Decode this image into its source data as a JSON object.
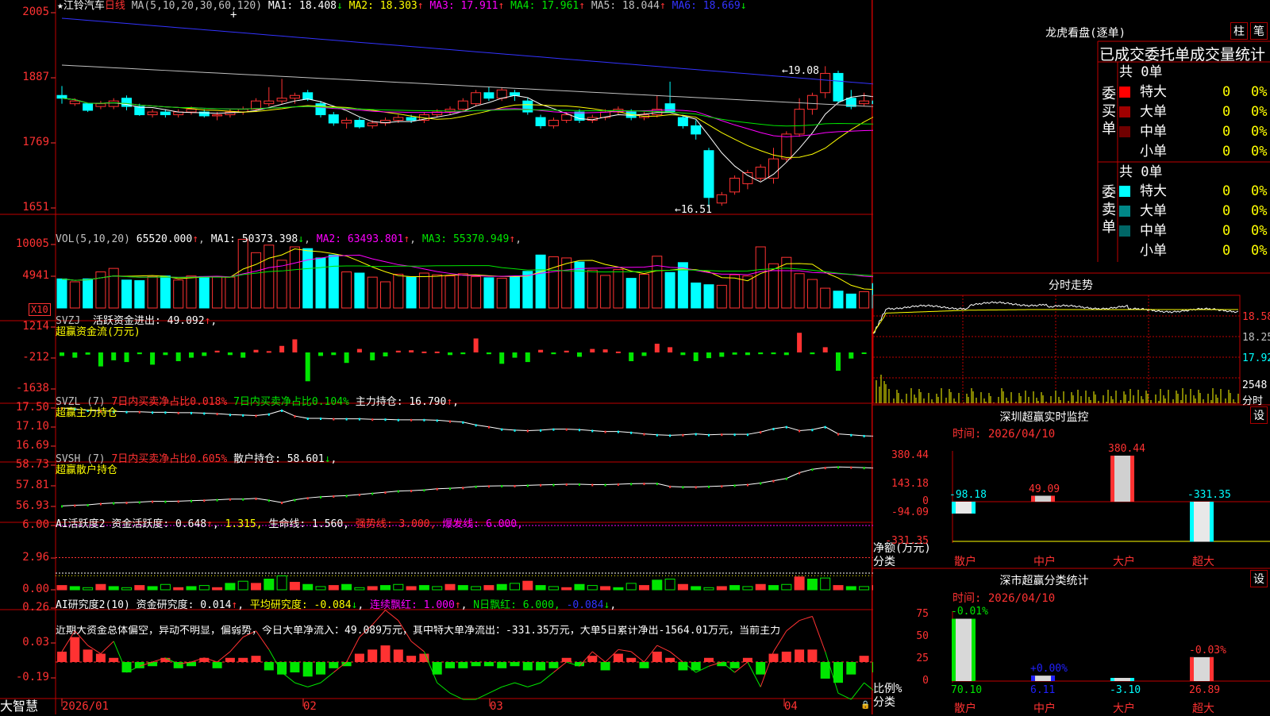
{
  "colors": {
    "up": "#ff3232",
    "down": "#00ffff",
    "green": "#00e600",
    "yellow": "#ffff00",
    "magenta": "#ff00ff",
    "blue": "#3333ff",
    "grid": "#c00000",
    "white": "#ffffff"
  },
  "kline": {
    "title_star": "★",
    "stock": "江铃汽车",
    "period": "日线",
    "ma_params": "MA(5,10,20,30,60,120)",
    "ma": [
      {
        "label": "MA1: 18.408",
        "arrow": "↓",
        "color": "#ffffff"
      },
      {
        "label": "MA2: 18.303",
        "arrow": "↑",
        "color": "#ffff00"
      },
      {
        "label": "MA3: 17.911",
        "arrow": "↑",
        "color": "#ff00ff"
      },
      {
        "label": "MA4: 17.961",
        "arrow": "↑",
        "color": "#00e600"
      },
      {
        "label": "MA5: 18.044",
        "arrow": "↑",
        "color": "#c0c0c0"
      },
      {
        "label": "MA6: 18.669",
        "arrow": "↓",
        "color": "#3333ff"
      }
    ],
    "y_ticks": [
      "2005",
      "1887",
      "1769",
      "1651"
    ],
    "high_label": "←19.08",
    "low_label": "←16.51",
    "candles": [
      [
        18.55,
        18.72,
        18.4,
        18.5
      ],
      [
        18.4,
        18.5,
        18.36,
        18.45
      ],
      [
        18.4,
        18.4,
        18.25,
        18.28
      ],
      [
        18.35,
        18.45,
        18.3,
        18.4
      ],
      [
        18.35,
        18.5,
        18.3,
        18.45
      ],
      [
        18.5,
        18.55,
        18.28,
        18.35
      ],
      [
        18.35,
        18.4,
        18.18,
        18.2
      ],
      [
        18.2,
        18.3,
        18.15,
        18.25
      ],
      [
        18.25,
        18.3,
        18.15,
        18.2
      ],
      [
        18.2,
        18.3,
        18.15,
        18.25
      ],
      [
        18.25,
        18.35,
        18.2,
        18.3
      ],
      [
        18.25,
        18.3,
        18.15,
        18.18
      ],
      [
        18.18,
        18.25,
        18.1,
        18.2
      ],
      [
        18.2,
        18.3,
        18.15,
        18.25
      ],
      [
        18.25,
        18.35,
        18.2,
        18.3
      ],
      [
        18.3,
        18.5,
        18.25,
        18.45
      ],
      [
        18.4,
        18.7,
        18.35,
        18.45
      ],
      [
        18.45,
        18.85,
        18.4,
        18.5
      ],
      [
        18.5,
        18.6,
        18.4,
        18.55
      ],
      [
        18.6,
        18.65,
        18.45,
        18.48
      ],
      [
        18.4,
        18.45,
        18.15,
        18.2
      ],
      [
        18.2,
        18.25,
        18.0,
        18.05
      ],
      [
        18.05,
        18.15,
        17.95,
        18.1
      ],
      [
        18.1,
        18.15,
        17.95,
        17.98
      ],
      [
        18.0,
        18.1,
        17.95,
        18.05
      ],
      [
        18.05,
        18.15,
        18.0,
        18.1
      ],
      [
        18.1,
        18.2,
        18.05,
        18.15
      ],
      [
        18.15,
        18.2,
        18.05,
        18.1
      ],
      [
        18.1,
        18.25,
        18.05,
        18.2
      ],
      [
        18.2,
        18.3,
        18.15,
        18.25
      ],
      [
        18.25,
        18.35,
        18.2,
        18.3
      ],
      [
        18.3,
        18.5,
        18.25,
        18.45
      ],
      [
        18.4,
        18.65,
        18.35,
        18.6
      ],
      [
        18.6,
        18.7,
        18.45,
        18.5
      ],
      [
        18.5,
        18.7,
        18.45,
        18.65
      ],
      [
        18.6,
        18.65,
        18.45,
        18.55
      ],
      [
        18.45,
        18.5,
        18.2,
        18.25
      ],
      [
        18.15,
        18.2,
        17.95,
        18.0
      ],
      [
        18.0,
        18.15,
        17.95,
        18.1
      ],
      [
        18.1,
        18.25,
        18.05,
        18.2
      ],
      [
        18.25,
        18.3,
        18.05,
        18.1
      ],
      [
        18.1,
        18.2,
        18.05,
        18.15
      ],
      [
        18.15,
        18.3,
        18.1,
        18.25
      ],
      [
        18.25,
        18.35,
        18.2,
        18.3
      ],
      [
        18.25,
        18.3,
        18.1,
        18.15
      ],
      [
        18.15,
        18.25,
        18.1,
        18.2
      ],
      [
        18.2,
        18.55,
        18.15,
        18.3
      ],
      [
        18.4,
        18.8,
        18.35,
        18.25
      ],
      [
        18.15,
        18.2,
        17.95,
        18.0
      ],
      [
        18.0,
        18.1,
        17.75,
        17.85
      ],
      [
        17.55,
        17.6,
        16.51,
        16.7
      ],
      [
        16.6,
        16.8,
        16.55,
        16.75
      ],
      [
        16.8,
        17.1,
        16.75,
        17.05
      ],
      [
        16.95,
        17.2,
        16.85,
        17.15
      ],
      [
        17.05,
        17.3,
        17.0,
        17.25
      ],
      [
        17.05,
        17.6,
        16.95,
        17.4
      ],
      [
        17.4,
        17.9,
        17.35,
        17.85
      ],
      [
        17.85,
        18.5,
        17.8,
        18.3
      ],
      [
        18.3,
        18.6,
        18.2,
        18.55
      ],
      [
        18.6,
        19.08,
        18.5,
        18.95
      ],
      [
        18.95,
        19.0,
        18.4,
        18.45
      ],
      [
        18.5,
        18.65,
        18.3,
        18.35
      ],
      [
        18.4,
        18.6,
        18.35,
        18.45
      ],
      [
        18.45,
        18.55,
        18.35,
        18.4
      ],
      [
        18.4,
        18.85,
        18.35,
        18.75
      ]
    ]
  },
  "vol": {
    "label": "VOL(5,10,20)",
    "value": "65520.000",
    "value_arrow": "↑",
    "ma": [
      {
        "label": "MA1: 50373.398",
        "arrow": "↓",
        "color": "#ffffff"
      },
      {
        "label": "MA2: 63493.801",
        "arrow": "↑",
        "color": "#ff00ff"
      },
      {
        "label": "MA3: 55370.949",
        "arrow": "↑",
        "color": "#00e600"
      }
    ],
    "y_ticks": [
      "10005",
      "4941"
    ],
    "unit": "X10",
    "bars": [
      5,
      4.5,
      5,
      6.2,
      6.8,
      4.8,
      4.7,
      5.4,
      5.5,
      4.8,
      5.5,
      5.4,
      5.4,
      5.3,
      11.8,
      9.5,
      10.8,
      8.2,
      10.5,
      10.2,
      8.6,
      9.1,
      6.2,
      6,
      5.3,
      4.5,
      5.8,
      5.3,
      6,
      5.7,
      5.5,
      5.9,
      5.4,
      5.2,
      5.1,
      5.4,
      6.3,
      9.1,
      8.8,
      8.6,
      7.9,
      6.5,
      5.6,
      6.6,
      5.1,
      5.8,
      8.9,
      6.1,
      7.8,
      4.3,
      4,
      3.9,
      5.7,
      5.5,
      10.5,
      7.6,
      8.7,
      5.9,
      4.9,
      3.4,
      2.9,
      2.4,
      2.8,
      4.2,
      4.7
    ]
  },
  "svzj": {
    "name": "SVZJ",
    "desc": "活跃资金进出: 49.092",
    "arrow": "↑",
    "sub": "超赢资金流(万元)",
    "y_ticks": [
      "1214",
      "-212",
      "-1638"
    ],
    "bars": [
      -80,
      -120,
      -50,
      -320,
      -180,
      -220,
      -40,
      -280,
      -60,
      -200,
      -120,
      -80,
      40,
      -60,
      -120,
      60,
      30,
      150,
      300,
      -660,
      -80,
      -60,
      -240,
      80,
      -180,
      -90,
      40,
      50,
      20,
      20,
      -60,
      -40,
      320,
      -40,
      -260,
      -120,
      -220,
      60,
      -40,
      40,
      -100,
      80,
      70,
      20,
      -200,
      -80,
      200,
      120,
      -60,
      -200,
      -130,
      -100,
      -50,
      -60,
      -40,
      -40,
      -60,
      450,
      -40,
      120,
      -420,
      -140,
      -30,
      -90,
      30
    ]
  },
  "svzl": {
    "name": "SVZL (7)",
    "desc1": "7日内买卖净占比0.018%",
    "desc2": "7日内买卖净占比0.104%",
    "desc3": "主力持仓: 16.790",
    "arrow": "↑",
    "sub": "超赢主力持仓",
    "y_ticks": [
      "17.50",
      "17.10",
      "16.69"
    ],
    "line": [
      17.5,
      17.48,
      17.45,
      17.44,
      17.43,
      17.42,
      17.42,
      17.41,
      17.41,
      17.4,
      17.4,
      17.39,
      17.38,
      17.36,
      17.35,
      17.34,
      17.37,
      17.45,
      17.33,
      17.28,
      17.28,
      17.27,
      17.27,
      17.27,
      17.26,
      17.26,
      17.25,
      17.25,
      17.25,
      17.24,
      17.22,
      17.2,
      17.14,
      17.1,
      17.05,
      17.03,
      17.02,
      17.03,
      17.05,
      17.05,
      17.04,
      17.02,
      17.0,
      17.0,
      16.98,
      16.95,
      16.93,
      16.92,
      16.93,
      16.95,
      16.93,
      16.94,
      16.94,
      16.94,
      16.99,
      17.06,
      17.1,
      17.02,
      17.04,
      17.1,
      16.95,
      16.93,
      16.91,
      16.9,
      16.79
    ]
  },
  "svsh": {
    "name": "SVSH (7)",
    "desc1": "7日内买卖净占比0.605%",
    "desc2": "散户持仓: 58.601",
    "arrow": "↓",
    "sub": "超赢散户持仓",
    "y_ticks": [
      "58.73",
      "57.81",
      "56.93"
    ],
    "line": [
      56.95,
      56.98,
      57.0,
      57.05,
      57.08,
      57.1,
      57.12,
      57.15,
      57.15,
      57.16,
      57.18,
      57.2,
      57.22,
      57.25,
      57.25,
      57.28,
      57.2,
      57.1,
      57.22,
      57.3,
      57.35,
      57.38,
      57.4,
      57.45,
      57.5,
      57.55,
      57.6,
      57.62,
      57.65,
      57.7,
      57.72,
      57.75,
      57.8,
      57.82,
      57.83,
      57.83,
      57.85,
      57.87,
      57.88,
      57.9,
      57.9,
      57.88,
      57.88,
      57.9,
      57.92,
      57.93,
      57.93,
      57.8,
      57.78,
      57.78,
      57.8,
      57.82,
      57.85,
      57.88,
      57.95,
      58.05,
      58.15,
      58.4,
      58.55,
      58.62,
      58.65,
      58.64,
      58.62,
      58.6,
      58.6
    ]
  },
  "ai1": {
    "name": "AI活跃度2",
    "desc": "资金活跃度: 0.648",
    "a1": "↑",
    "v2": "1.315,",
    "v3": "生命线: 1.560,",
    "v4": "强势线: 3.000,",
    "v5": "爆发线: 6.000,",
    "y_ticks": [
      "6.00",
      "2.96",
      "0.00"
    ],
    "bars": [
      0.4,
      0.3,
      0.2,
      0.5,
      0.3,
      0.2,
      0.4,
      0.3,
      0.5,
      0.2,
      0.3,
      0.4,
      0.2,
      0.6,
      0.8,
      0.6,
      1.0,
      1.3,
      0.7,
      0.5,
      0.3,
      0.4,
      0.5,
      0.2,
      0.3,
      0.4,
      0.5,
      0.3,
      0.4,
      0.3,
      0.5,
      0.4,
      0.3,
      0.4,
      0.5,
      0.6,
      0.8,
      0.4,
      0.3,
      0.2,
      0.5,
      0.4,
      0.3,
      0.2,
      0.6,
      0.4,
      0.9,
      1.0,
      0.5,
      0.3,
      0.2,
      0.3,
      0.4,
      0.3,
      0.5,
      0.4,
      0.5,
      1.2,
      1.0,
      1.1,
      0.4,
      0.3,
      0.3,
      0.4,
      0.5
    ]
  },
  "ai2": {
    "name": "AI研究度2(10)",
    "desc": "资金研究度: 0.014",
    "a1": "↑",
    "v2": "平均研究度: -0.084",
    "a2": "↓",
    "v3": "连续飘红: 1.000",
    "a3": "↑",
    "v4": "N日飘红: 6.000,",
    "v5": "-0.084",
    "a5": "↓",
    "summary": "近期大资金总体偏空，异动不明显，偏弱势，今日大单净流入：49.089万元，其中特大单净流出：-331.35万元，大单5日累计净出-1564.01万元，当前主力",
    "y_ticks": [
      "0.26",
      "0.03",
      "-0.19"
    ],
    "bars": [
      0.05,
      0.12,
      0.06,
      0.04,
      0.02,
      -0.05,
      -0.03,
      -0.02,
      0.02,
      -0.03,
      -0.02,
      0.02,
      -0.03,
      0.02,
      0.02,
      0.03,
      -0.04,
      -0.06,
      -0.05,
      -0.07,
      -0.06,
      -0.03,
      -0.02,
      0.04,
      0.06,
      0.08,
      0.06,
      0.03,
      0.04,
      -0.06,
      -0.03,
      -0.03,
      -0.02,
      -0.02,
      -0.03,
      -0.02,
      -0.04,
      -0.04,
      -0.03,
      0.02,
      -0.02,
      0.03,
      -0.04,
      0.04,
      0.02,
      -0.03,
      0.05,
      0.02,
      -0.04,
      -0.04,
      0.02,
      -0.02,
      -0.03,
      0.02,
      -0.06,
      0.04,
      0.05,
      0.06,
      0.06,
      -0.08,
      -0.1,
      -0.06,
      0.03,
      -0.05,
      0.02
    ],
    "line": [
      0.05,
      0.15,
      0.08,
      0.04,
      0.1,
      -0.05,
      -0.02,
      0.0,
      0.02,
      -0.01,
      0.0,
      0.02,
      0.0,
      0.05,
      0.12,
      0.15,
      0.06,
      -0.05,
      -0.1,
      -0.12,
      -0.1,
      -0.05,
      0.0,
      0.12,
      0.18,
      0.25,
      0.2,
      0.1,
      0.05,
      -0.1,
      -0.15,
      -0.18,
      -0.18,
      -0.15,
      -0.12,
      -0.1,
      -0.12,
      -0.1,
      -0.05,
      0.0,
      -0.02,
      0.05,
      0.0,
      0.06,
      0.05,
      0.0,
      0.08,
      0.05,
      0.0,
      -0.05,
      -0.02,
      0.0,
      -0.05,
      0.0,
      -0.12,
      0.05,
      0.15,
      0.2,
      0.22,
      0.05,
      -0.15,
      -0.18,
      -0.1,
      -0.15,
      -0.05
    ]
  },
  "dates": [
    "2026/01",
    "02",
    "03",
    "04"
  ],
  "brand": "大智慧",
  "right": {
    "dragon_title": "龙虎看盘(逐单)",
    "btn_bar": "柱",
    "btn_pen": "笔",
    "head": "已成交委托单成交量统计",
    "buy_label": "委买单",
    "sell_label": "委卖单",
    "buy_total": "共 0单",
    "sell_total": "共 0单",
    "buy_rows": [
      {
        "name": "特大",
        "n": "0",
        "p": "0%",
        "c": "#ff0000"
      },
      {
        "name": "大单",
        "n": "0",
        "p": "0%",
        "c": "#a00000"
      },
      {
        "name": "中单",
        "n": "0",
        "p": "0%",
        "c": "#700000"
      },
      {
        "name": "小单",
        "n": "0",
        "p": "0%",
        "c": "#000000"
      }
    ],
    "sell_rows": [
      {
        "name": "特大",
        "n": "0",
        "p": "0%",
        "c": "#00ffff"
      },
      {
        "name": "大单",
        "n": "0",
        "p": "0%",
        "c": "#008888"
      },
      {
        "name": "中单",
        "n": "0",
        "p": "0%",
        "c": "#006666"
      },
      {
        "name": "小单",
        "n": "0",
        "p": "0%",
        "c": "#000000"
      }
    ],
    "fenshi_title": "分时走势",
    "fenshi_ticks": [
      "18.58",
      "18.25",
      "17.92",
      "2548",
      "分时"
    ],
    "monitor_title": "深圳超赢实时监控",
    "monitor_btn": "设",
    "monitor_time": "时间: 2026/04/10",
    "monitor_y": [
      "380.44",
      "143.18",
      "0",
      "-94.09",
      "-331.35"
    ],
    "monitor_left": "净额(万元)",
    "monitor_cat_label": "分类",
    "monitor_cats": [
      "散户",
      "中户",
      "大户",
      "超大"
    ],
    "monitor_vals": [
      -98.18,
      49.09,
      380.44,
      -331.35
    ],
    "monitor_val_labels": [
      "-98.18",
      "49.09",
      "380.44",
      "-331.35"
    ],
    "class_title": "深市超赢分类统计",
    "class_btn": "设",
    "class_time": "时间: 2026/04/10",
    "class_y": [
      "75",
      "50",
      "25",
      "0"
    ],
    "class_left": "比例%",
    "class_cat_label": "分类",
    "class_cats": [
      "散户",
      "中户",
      "大户",
      "超大"
    ],
    "class_vals": [
      70.1,
      6.11,
      -3.1,
      26.89
    ],
    "class_val_labels": [
      "70.10",
      "6.11",
      "-3.10",
      "26.89"
    ],
    "class_top_labels": [
      "-0.01%",
      "+0.00%",
      "",
      "-0.03%"
    ]
  }
}
